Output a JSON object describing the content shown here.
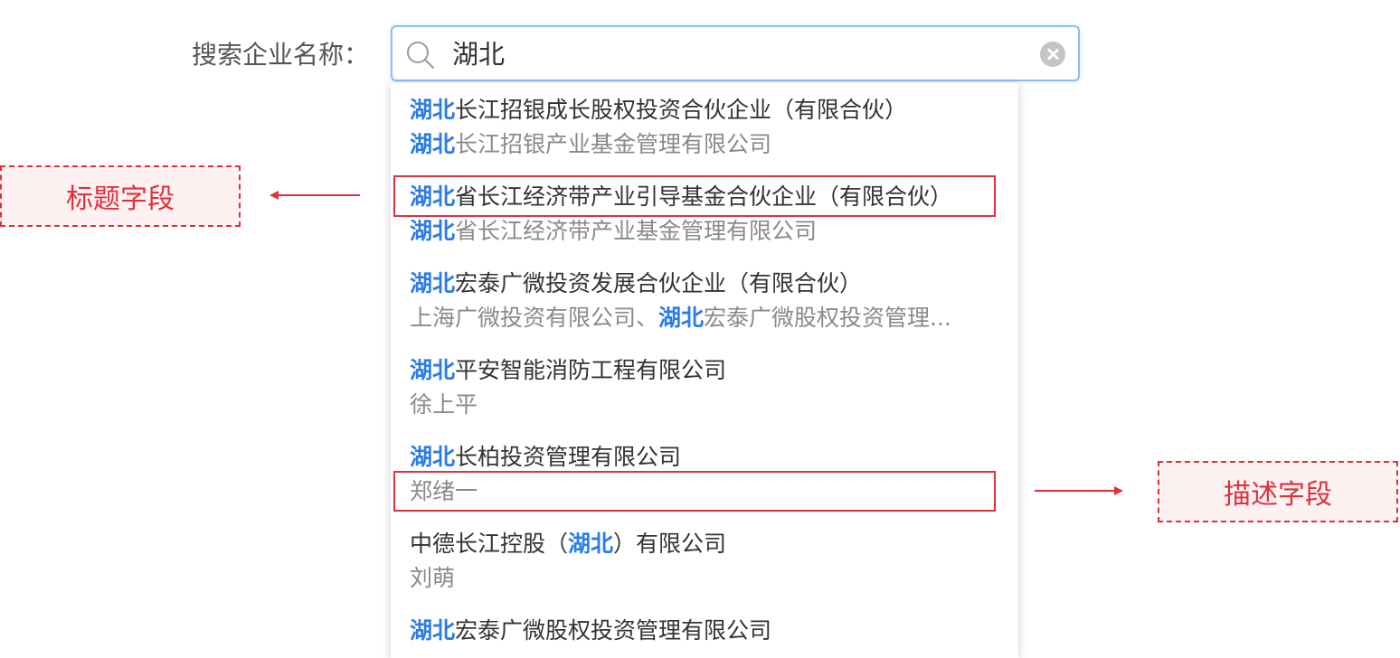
{
  "search": {
    "label": "搜索企业名称：",
    "value": "湖北",
    "accent_color": "#2b7ce9"
  },
  "results": [
    {
      "title": [
        {
          "t": "湖北",
          "hl": true
        },
        {
          "t": "长江招银成长股权投资合伙企业（有限合伙）",
          "hl": false
        }
      ],
      "desc": [
        {
          "t": "湖北",
          "hl": true
        },
        {
          "t": "长江招银产业基金管理有限公司",
          "hl": false
        }
      ]
    },
    {
      "title": [
        {
          "t": "湖北",
          "hl": true
        },
        {
          "t": "省长江经济带产业引导基金合伙企业（有限合伙）",
          "hl": false
        }
      ],
      "desc": [
        {
          "t": "湖北",
          "hl": true
        },
        {
          "t": "省长江经济带产业基金管理有限公司",
          "hl": false
        }
      ]
    },
    {
      "title": [
        {
          "t": "湖北",
          "hl": true
        },
        {
          "t": "宏泰广微投资发展合伙企业（有限合伙）",
          "hl": false
        }
      ],
      "desc": [
        {
          "t": "上海广微投资有限公司、",
          "hl": false
        },
        {
          "t": "湖北",
          "hl": true
        },
        {
          "t": "宏泰广微股权投资管理...",
          "hl": false
        }
      ]
    },
    {
      "title": [
        {
          "t": "湖北",
          "hl": true
        },
        {
          "t": "平安智能消防工程有限公司",
          "hl": false
        }
      ],
      "desc": [
        {
          "t": "徐上平",
          "hl": false
        }
      ]
    },
    {
      "title": [
        {
          "t": "湖北",
          "hl": true
        },
        {
          "t": "长柏投资管理有限公司",
          "hl": false
        }
      ],
      "desc": [
        {
          "t": "郑绪一",
          "hl": false
        }
      ]
    },
    {
      "title": [
        {
          "t": "中德长江控股（",
          "hl": false
        },
        {
          "t": "湖北",
          "hl": true
        },
        {
          "t": "）有限公司",
          "hl": false
        }
      ],
      "desc": [
        {
          "t": "刘萌",
          "hl": false
        }
      ]
    },
    {
      "title": [
        {
          "t": "湖北",
          "hl": true
        },
        {
          "t": "宏泰广微股权投资管理有限公司",
          "hl": false
        }
      ],
      "desc": []
    }
  ],
  "annotations": {
    "title_field_label": "标题字段",
    "desc_field_label": "描述字段",
    "color": "#e0303a"
  }
}
